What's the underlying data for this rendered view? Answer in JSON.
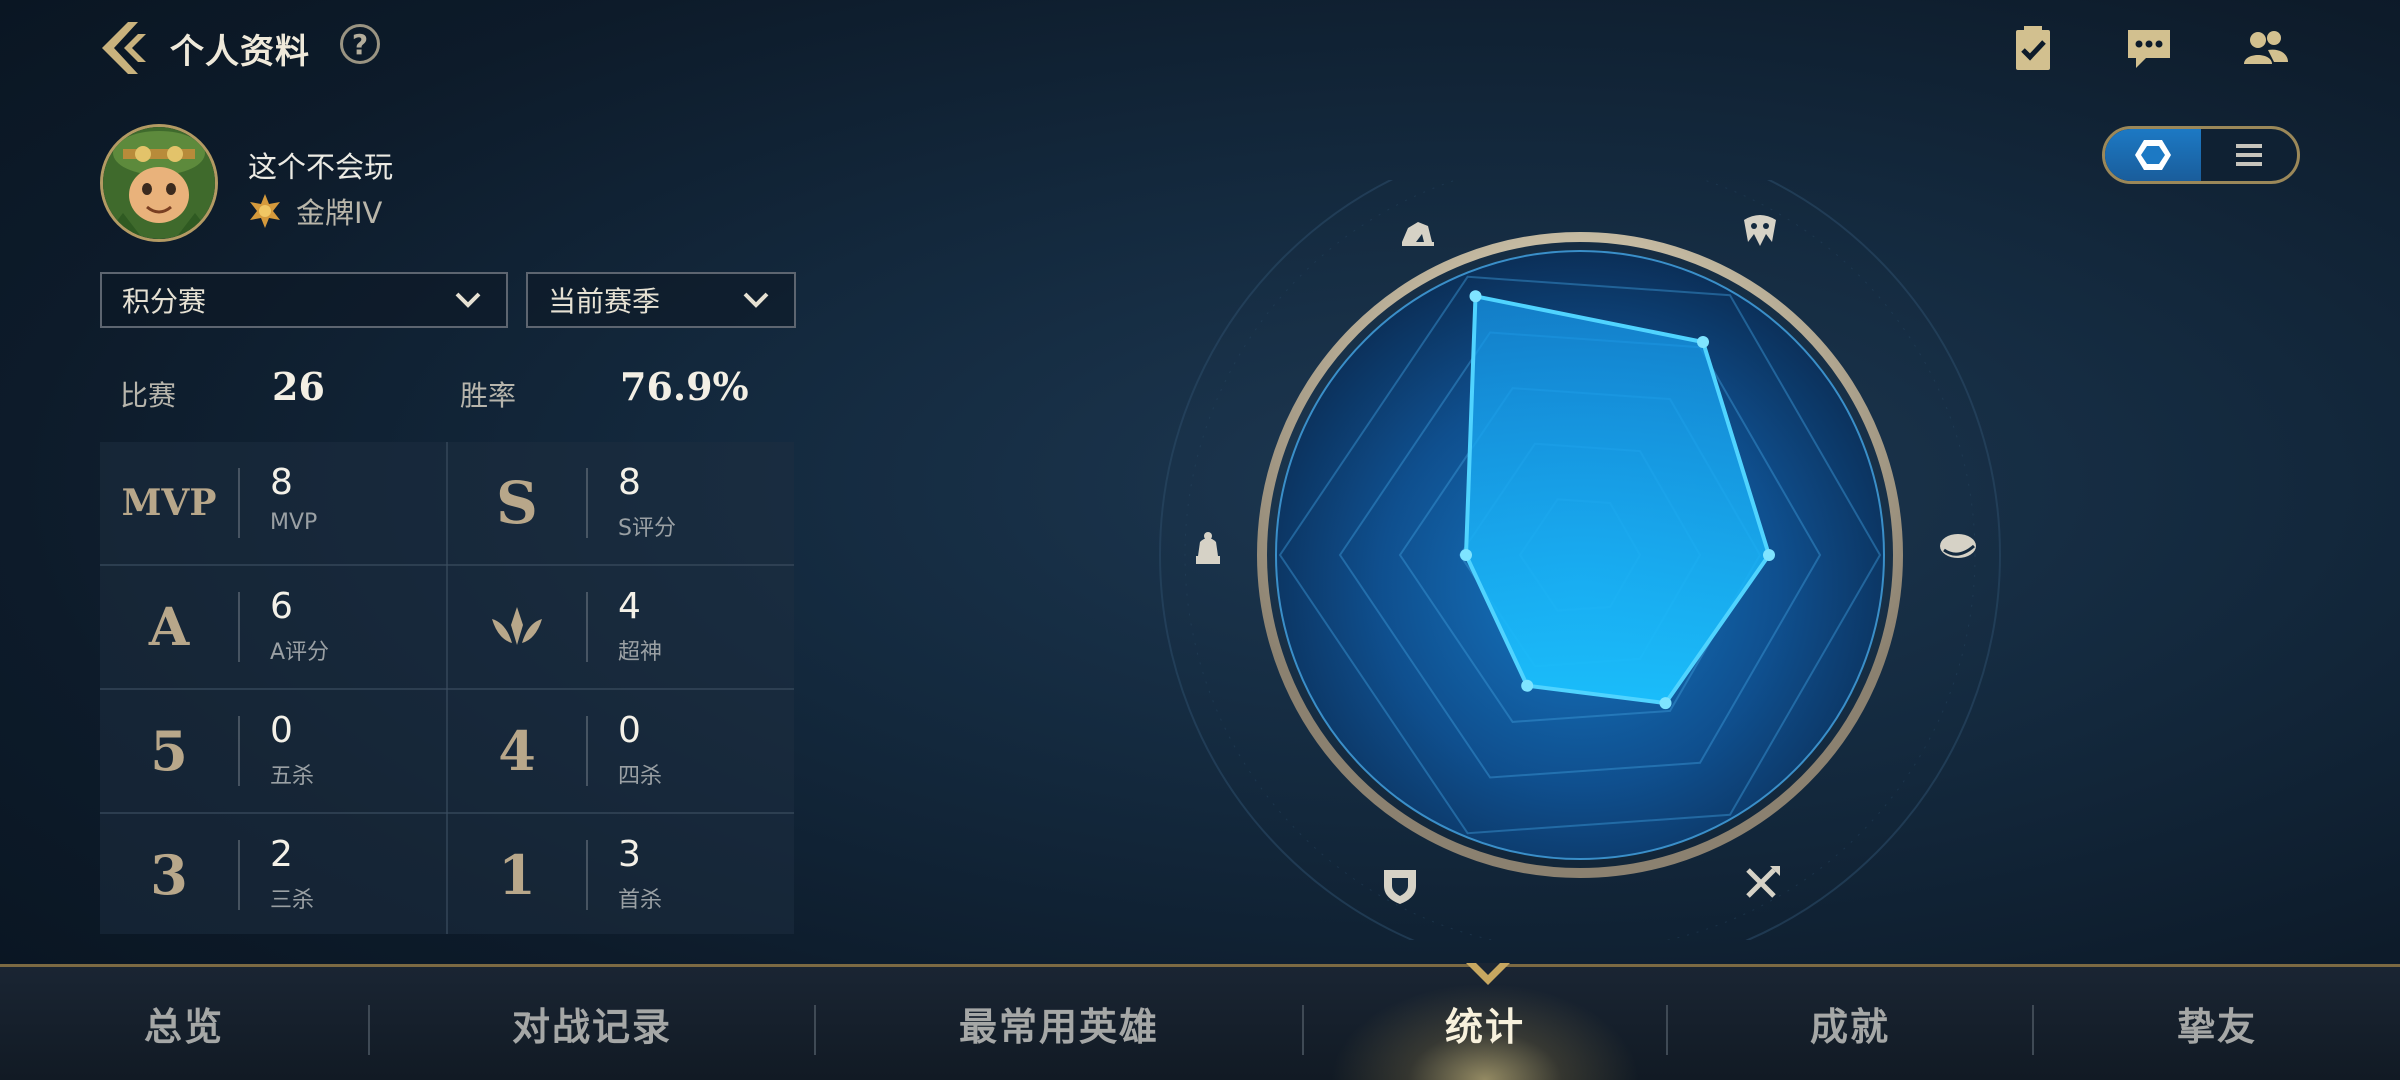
{
  "header": {
    "title": "个人资料",
    "help_label": "?"
  },
  "profile": {
    "name": "这个不会玩",
    "rank": "金牌IV"
  },
  "filters": {
    "mode": "积分赛",
    "season": "当前赛季"
  },
  "summary": {
    "matches_label": "比赛",
    "matches_value": "26",
    "winrate_label": "胜率",
    "winrate_value": "76.9%"
  },
  "stats": [
    {
      "icon": "mvp-icon",
      "glyph": "MVP",
      "value": "8",
      "label": "MVP"
    },
    {
      "icon": "s-rating-icon",
      "glyph": "S",
      "value": "8",
      "label": "S评分"
    },
    {
      "icon": "a-rating-icon",
      "glyph": "A",
      "value": "6",
      "label": "A评分"
    },
    {
      "icon": "legendary-icon",
      "glyph": "",
      "value": "4",
      "label": "超神"
    },
    {
      "icon": "penta-kill-icon",
      "glyph": "5",
      "value": "0",
      "label": "五杀"
    },
    {
      "icon": "quadra-kill-icon",
      "glyph": "4",
      "value": "0",
      "label": "四杀"
    },
    {
      "icon": "triple-kill-icon",
      "glyph": "3",
      "value": "2",
      "label": "三杀"
    },
    {
      "icon": "first-blood-icon",
      "glyph": "1",
      "value": "3",
      "label": "首杀"
    }
  ],
  "radar": {
    "axes": [
      "fighter-icon",
      "assassin-icon",
      "tank-helmet-icon",
      "marksman-icon",
      "support-shield-icon",
      "mage-icon"
    ],
    "values": [
      0.93,
      0.82,
      0.63,
      0.57,
      0.47,
      0.38
    ],
    "fill_color": "#12a8f0",
    "line_color": "#4fd2ff"
  },
  "view_toggle": {
    "selected": "radar",
    "options": [
      "radar",
      "list"
    ]
  },
  "nav": {
    "tabs": [
      "总览",
      "对战记录",
      "最常用英雄",
      "统计",
      "成就",
      "挚友"
    ],
    "active": 3
  },
  "colors": {
    "accent": "#b39a63",
    "active_blue": "#1c79c4"
  }
}
